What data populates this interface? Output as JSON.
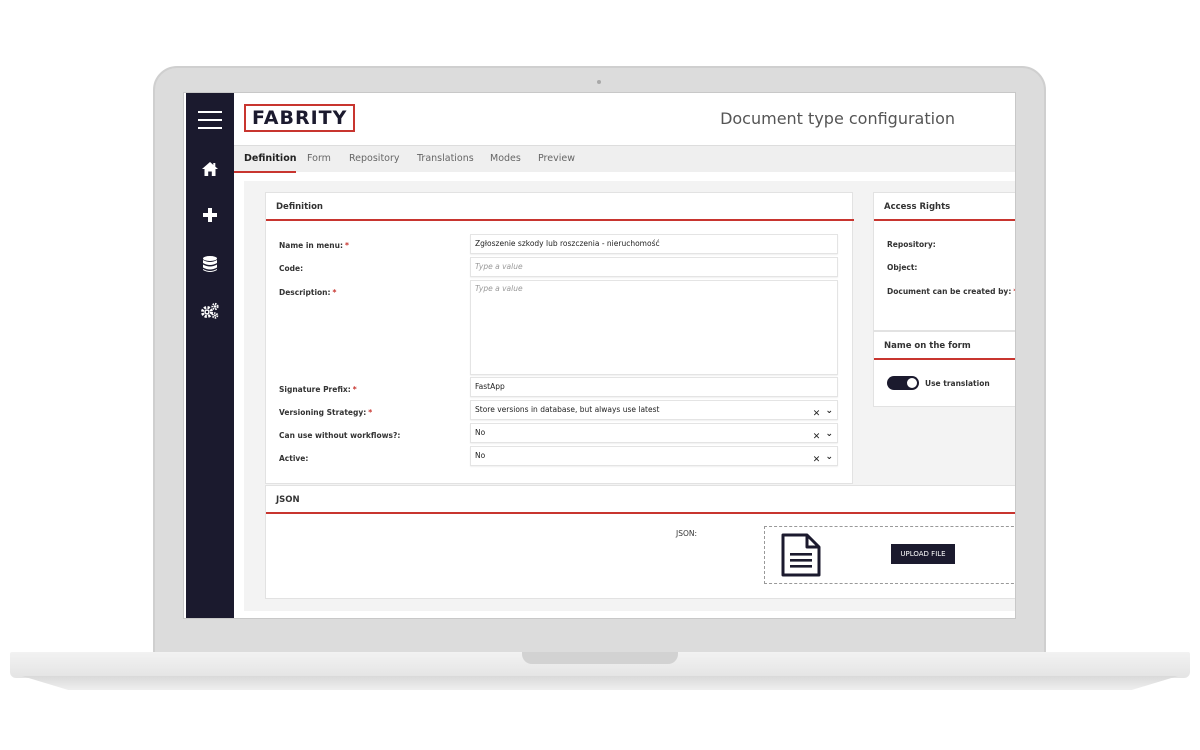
{
  "header": {
    "logo_text": "FABRITY",
    "title": "Document type configuration"
  },
  "sidebar": {
    "icons": [
      "menu-icon",
      "home-icon",
      "plus-icon",
      "database-icon",
      "gears-icon"
    ]
  },
  "tabs": [
    {
      "label": "Definition",
      "active": true
    },
    {
      "label": "Form"
    },
    {
      "label": "Repository"
    },
    {
      "label": "Translations"
    },
    {
      "label": "Modes"
    },
    {
      "label": "Preview"
    }
  ],
  "definition": {
    "title": "Definition",
    "fields": {
      "name_in_menu": {
        "label": "Name in menu:",
        "value": "Zgłoszenie szkody lub roszczenia - nieruchomość"
      },
      "code": {
        "label": "Code:",
        "placeholder": "Type a value"
      },
      "description": {
        "label": "Description:",
        "placeholder": "Type a value"
      },
      "signature_prefix": {
        "label": "Signature Prefix:",
        "value": "FastApp"
      },
      "versioning_strategy": {
        "label": "Versioning Strategy:",
        "value": "Store versions in database, but always use latest"
      },
      "workflows": {
        "label": "Can use without workflows?:",
        "value": "No"
      },
      "active": {
        "label": "Active:",
        "value": "No"
      }
    },
    "clear_symbol": "✕",
    "chevron_symbol": "⌄"
  },
  "access_rights": {
    "title": "Access Rights",
    "repository_label": "Repository:",
    "object_label": "Object:",
    "created_by_label": "Document can be created by:"
  },
  "name_on_form": {
    "title": "Name on the form",
    "toggle_label": "Use translation",
    "toggle_on": true
  },
  "json_section": {
    "title": "JSON",
    "field_label": "JSON:",
    "upload_label": "UPLOAD FILE"
  },
  "required_mark": "*",
  "colors": {
    "accent": "#c8352f",
    "dark": "#1b1a2e"
  }
}
